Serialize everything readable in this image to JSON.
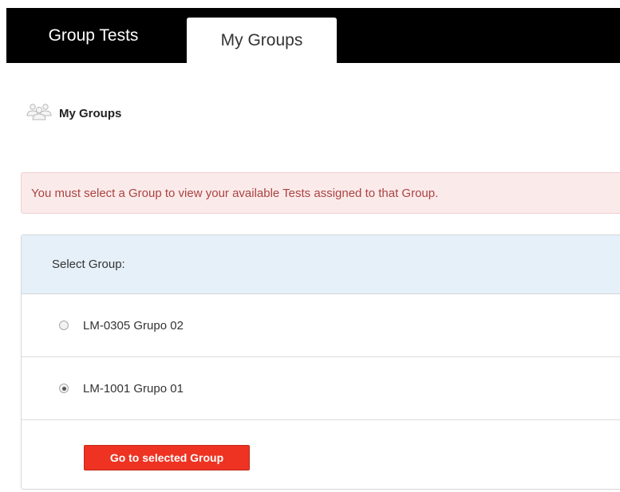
{
  "tabs": [
    {
      "label": "Group Tests",
      "active": false
    },
    {
      "label": "My Groups",
      "active": true
    }
  ],
  "page": {
    "title": "My Groups",
    "icon": "users-group-icon"
  },
  "alert": {
    "message": "You must select a Group to view your available Tests assigned to that Group."
  },
  "panel": {
    "header": "Select Group:",
    "options": [
      {
        "label": "LM-0305 Grupo 02",
        "selected": false
      },
      {
        "label": "LM-1001 Grupo 01",
        "selected": true
      }
    ],
    "button_label": "Go to selected Group"
  },
  "colors": {
    "topbar": "#000000",
    "alert_bg": "#fbeaea",
    "alert_text": "#a94442",
    "panel_header_bg": "#e5f0f9",
    "button_bg": "#ee3322"
  }
}
